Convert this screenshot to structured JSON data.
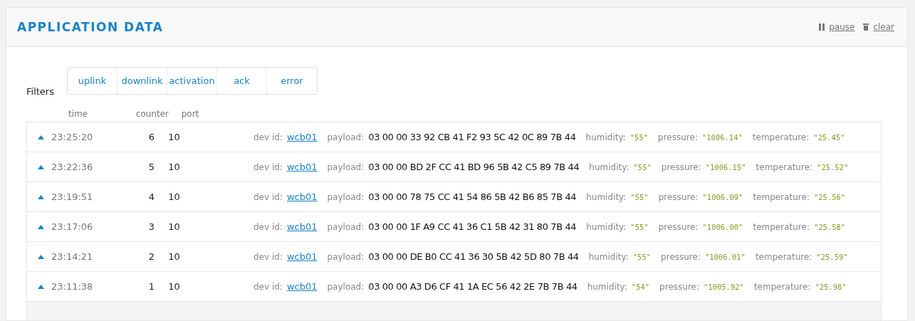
{
  "panel": {
    "title": "APPLICATION DATA",
    "actions": [
      {
        "kind": "pause",
        "label": "pause"
      },
      {
        "kind": "clear",
        "label": "clear"
      }
    ]
  },
  "filters": {
    "label": "Filters",
    "options": [
      "uplink",
      "downlink",
      "activation",
      "ack",
      "error"
    ]
  },
  "table": {
    "columns": [
      "time",
      "counter",
      "port"
    ],
    "rows": [
      {
        "time": "23:25:20",
        "counter": "6",
        "port": "10",
        "dev_id_label": "dev id:",
        "dev_id": "wcb01",
        "payload_label": "payload:",
        "payload": "03 00 00 33 92 CB 41 F2 93 5C 42 0C 89 7B 44",
        "fields": [
          {
            "name": "humidity:",
            "value": "\"55\""
          },
          {
            "name": "pressure:",
            "value": "\"1006.14\""
          },
          {
            "name": "temperature:",
            "value": "\"25.45\""
          }
        ]
      },
      {
        "time": "23:22:36",
        "counter": "5",
        "port": "10",
        "dev_id_label": "dev id:",
        "dev_id": "wcb01",
        "payload_label": "payload:",
        "payload": "03 00 00 BD 2F CC 41 BD 96 5B 42 C5 89 7B 44",
        "fields": [
          {
            "name": "humidity:",
            "value": "\"55\""
          },
          {
            "name": "pressure:",
            "value": "\"1006.15\""
          },
          {
            "name": "temperature:",
            "value": "\"25.52\""
          }
        ]
      },
      {
        "time": "23:19:51",
        "counter": "4",
        "port": "10",
        "dev_id_label": "dev id:",
        "dev_id": "wcb01",
        "payload_label": "payload:",
        "payload": "03 00 00 78 75 CC 41 54 86 5B 42 B6 85 7B 44",
        "fields": [
          {
            "name": "humidity:",
            "value": "\"55\""
          },
          {
            "name": "pressure:",
            "value": "\"1006.09\""
          },
          {
            "name": "temperature:",
            "value": "\"25.56\""
          }
        ]
      },
      {
        "time": "23:17:06",
        "counter": "3",
        "port": "10",
        "dev_id_label": "dev id:",
        "dev_id": "wcb01",
        "payload_label": "payload:",
        "payload": "03 00 00 1F A9 CC 41 36 C1 5B 42 31 80 7B 44",
        "fields": [
          {
            "name": "humidity:",
            "value": "\"55\""
          },
          {
            "name": "pressure:",
            "value": "\"1006.00\""
          },
          {
            "name": "temperature:",
            "value": "\"25.58\""
          }
        ]
      },
      {
        "time": "23:14:21",
        "counter": "2",
        "port": "10",
        "dev_id_label": "dev id:",
        "dev_id": "wcb01",
        "payload_label": "payload:",
        "payload": "03 00 00 DE B0 CC 41 36 30 5B 42 5D 80 7B 44",
        "fields": [
          {
            "name": "humidity:",
            "value": "\"55\""
          },
          {
            "name": "pressure:",
            "value": "\"1006.01\""
          },
          {
            "name": "temperature:",
            "value": "\"25.59\""
          }
        ]
      },
      {
        "time": "23:11:38",
        "counter": "1",
        "port": "10",
        "dev_id_label": "dev id:",
        "dev_id": "wcb01",
        "payload_label": "payload:",
        "payload": "03 00 00 A3 D6 CF 41 1A EC 56 42 2E 7B 7B 44",
        "fields": [
          {
            "name": "humidity:",
            "value": "\"54\""
          },
          {
            "name": "pressure:",
            "value": "\"1005.92\""
          },
          {
            "name": "temperature:",
            "value": "\"25.98\""
          }
        ]
      }
    ]
  }
}
